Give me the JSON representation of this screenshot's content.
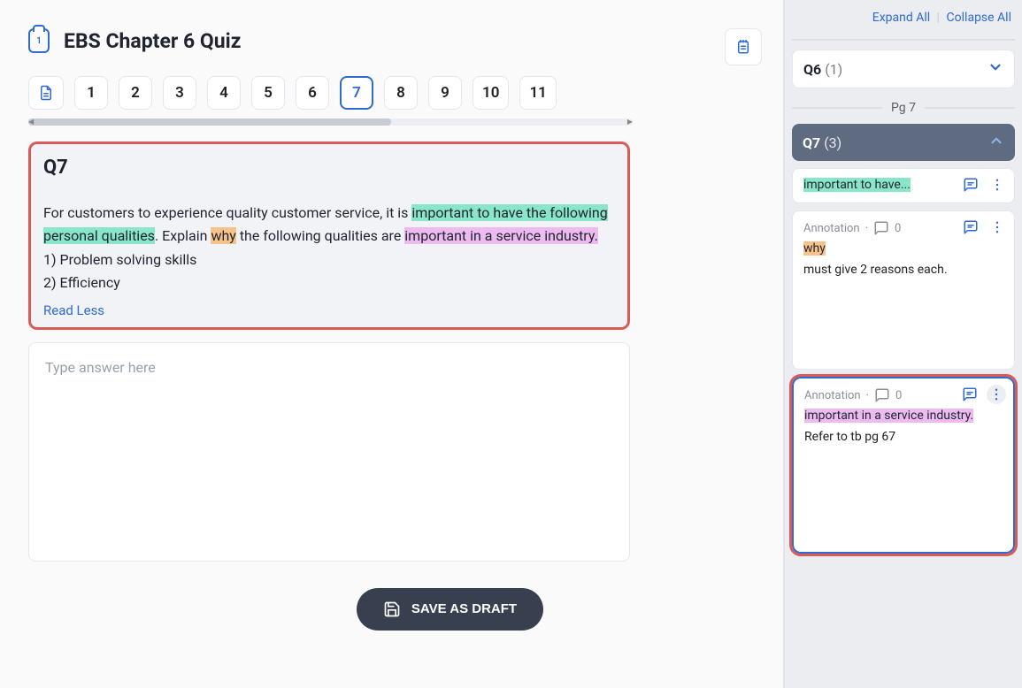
{
  "quiz": {
    "clip_number": "1",
    "title": "EBS Chapter 6 Quiz"
  },
  "tabs": {
    "items": [
      "1",
      "2",
      "3",
      "4",
      "5",
      "6",
      "7",
      "8",
      "9",
      "10",
      "11"
    ],
    "active_index": 6
  },
  "question": {
    "label": "Q7",
    "text_lead": "For customers to experience quality customer service, it is ",
    "hl1": "important to have the following personal qualities",
    "text_mid1": ". Explain ",
    "hl2": "why",
    "text_mid2": " the following qualities are ",
    "hl3": "important in a service industry.",
    "line1": "1) Problem solving skills",
    "line2": "2) Efficiency",
    "read_less": "Read Less"
  },
  "answer": {
    "placeholder": "Type answer here"
  },
  "save_label": "SAVE AS DRAFT",
  "side": {
    "expand": "Expand All",
    "collapse": "Collapse All",
    "q6": {
      "label": "Q6",
      "count": "(1)"
    },
    "page_label": "Pg 7",
    "q7": {
      "label": "Q7",
      "count": "(3)"
    },
    "ann1": {
      "snippet": "important to have..."
    },
    "ann2": {
      "meta_label": "Annotation",
      "comments": "0",
      "snippet": "why",
      "body": "must give 2 reasons each."
    },
    "ann3": {
      "meta_label": "Annotation",
      "comments": "0",
      "snippet": "important in a service industry.",
      "body": "Refer to tb pg 67"
    }
  }
}
